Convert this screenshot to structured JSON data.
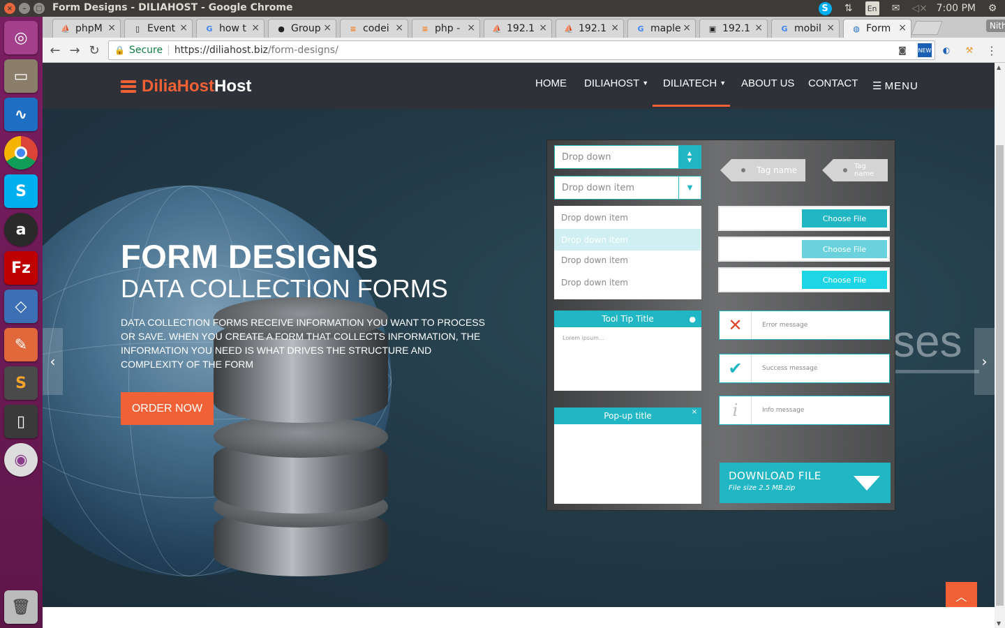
{
  "os": {
    "window_title": "Form Designs - DILIAHOST - Google Chrome",
    "clock": "7:00 PM",
    "keyboard_lang": "En"
  },
  "browser": {
    "tabs": [
      {
        "label": "phpM",
        "favicon": "pma"
      },
      {
        "label": "Event",
        "favicon": "doc"
      },
      {
        "label": "how t",
        "favicon": "google"
      },
      {
        "label": "Group",
        "favicon": "github"
      },
      {
        "label": "codei",
        "favicon": "stackoverflow"
      },
      {
        "label": "php -",
        "favicon": "stackoverflow"
      },
      {
        "label": "192.1",
        "favicon": "pma"
      },
      {
        "label": "192.1",
        "favicon": "pma"
      },
      {
        "label": "maple",
        "favicon": "google"
      },
      {
        "label": "192.1",
        "favicon": "image"
      },
      {
        "label": "mobil",
        "favicon": "google"
      },
      {
        "label": "Form",
        "favicon": "globe",
        "active": true
      }
    ],
    "profile_name": "Nithyashree",
    "address": {
      "secure_label": "Secure",
      "url_host": "https://diliahost.biz",
      "url_path": "/form-designs/"
    }
  },
  "site": {
    "logo": {
      "part1": "DiliaHost",
      "part2": "Host"
    },
    "nav": {
      "home": "HOME",
      "diliahost": "DILIAHOST",
      "diliatech": "DILIATECH",
      "about": "ABOUT US",
      "contact": "CONTACT",
      "menu": "MENU"
    },
    "hero": {
      "title": "FORM DESIGNS",
      "subtitle": "DATA COLLECTION FORMS",
      "description": "DATA COLLECTION FORMS RECEIVE INFORMATION YOU WANT TO PROCESS OR SAVE. WHEN YOU CREATE A FORM THAT COLLECTS INFORMATION, THE INFORMATION YOU NEED IS WHAT DRIVES THE STRUCTURE AND COMPLEXITY OF THE FORM",
      "cta": "ORDER NOW",
      "ghost_text": "ses"
    },
    "ui_kit": {
      "dropdown1": "Drop down",
      "dropdown2": "Drop down item",
      "list_items": [
        "Drop down item",
        "Drop down item",
        "Drop down item",
        "Drop down item"
      ],
      "tag1": "Tag name",
      "tag2": "Tag name",
      "choose_file": "Choose File",
      "tooltip_title": "Tool Tip Title",
      "tooltip_body": "Lorem ipsum...",
      "popup_title": "Pop-up title",
      "error_message": "Error message",
      "success_message": "Success message",
      "info_message": "Info message",
      "download_title": "DOWNLOAD FILE",
      "download_subtitle": "File size 2.5 MB.zip"
    }
  },
  "colors": {
    "accent": "#f26135",
    "teal": "#21b6c4",
    "header_bg": "#2e3138",
    "launcher_bg": "#6b1a55"
  }
}
